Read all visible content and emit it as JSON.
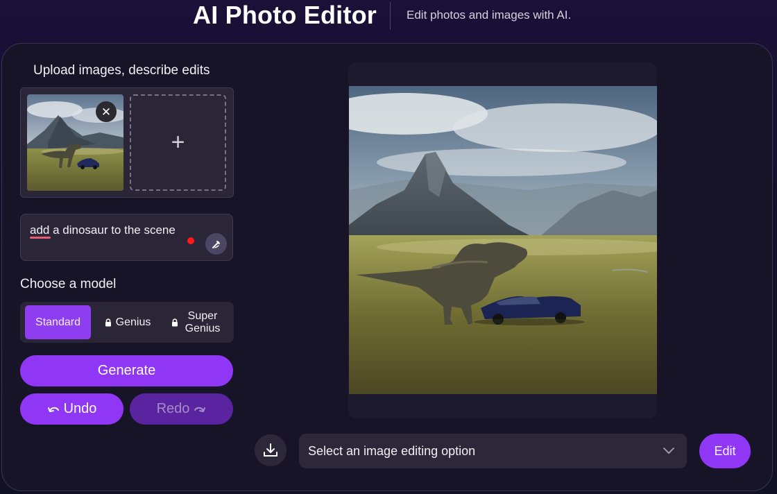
{
  "header": {
    "title": "AI Photo Editor",
    "subtitle": "Edit photos and images with AI."
  },
  "upload": {
    "section_title": "Upload images, describe edits",
    "remove_icon": "close-icon",
    "add_icon": "plus-icon"
  },
  "prompt": {
    "value": "add a dinosaur to the scene",
    "magic_icon": "magic-wand-icon"
  },
  "model": {
    "title": "Choose a model",
    "options": [
      {
        "label": "Standard",
        "locked": false,
        "selected": true
      },
      {
        "label": "Genius",
        "locked": true,
        "selected": false
      },
      {
        "label": "Super Genius",
        "locked": true,
        "selected": false
      }
    ]
  },
  "actions": {
    "generate_label": "Generate",
    "undo_label": "Undo",
    "undo_icon": "undo-arrow-icon",
    "redo_label": "Redo",
    "redo_icon": "redo-arrow-icon"
  },
  "editor": {
    "download_icon": "download-icon",
    "select_placeholder": "Select an image editing option",
    "edit_label": "Edit"
  },
  "colors": {
    "accent": "#9037f5",
    "accent_disabled": "#5a23a0",
    "background": "#181428",
    "panel": "#2a2638"
  }
}
